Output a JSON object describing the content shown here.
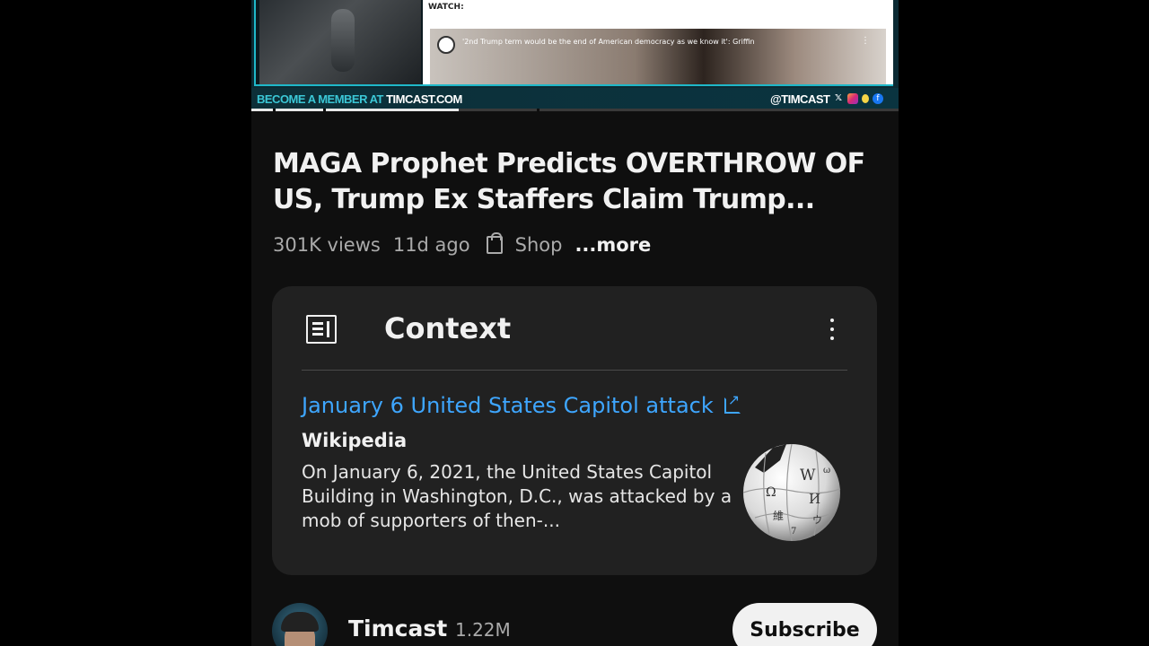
{
  "video": {
    "watch_label": "WATCH:",
    "embed_title": "'2nd Trump term would be the end of American democracy as we know it': Griffin",
    "member_prefix": "BECOME A MEMBER AT ",
    "member_site": "TIMCAST.COM",
    "handle": "@TIMCAST",
    "progress_fraction": 0.32
  },
  "title": "MAGA Prophet Predicts OVERTHROW OF US, Trump Ex Staffers Claim Trump...",
  "meta": {
    "views": "301K views",
    "age": "11d ago",
    "shop": "Shop",
    "more": "...more"
  },
  "context": {
    "heading": "Context",
    "link_text": "January 6 United States Capitol attack",
    "source": "Wikipedia",
    "description": "On January 6, 2021, the United States Capitol Building in Washington, D.C., was attacked by a mob of supporters of then-..."
  },
  "channel": {
    "name": "Timcast",
    "subscribers": "1.22M",
    "subscribe_label": "Subscribe"
  },
  "colors": {
    "link": "#3ea6ff",
    "card_bg": "#212121",
    "page_bg": "#0f0f0f",
    "brand_teal": "#3bc7d6"
  }
}
